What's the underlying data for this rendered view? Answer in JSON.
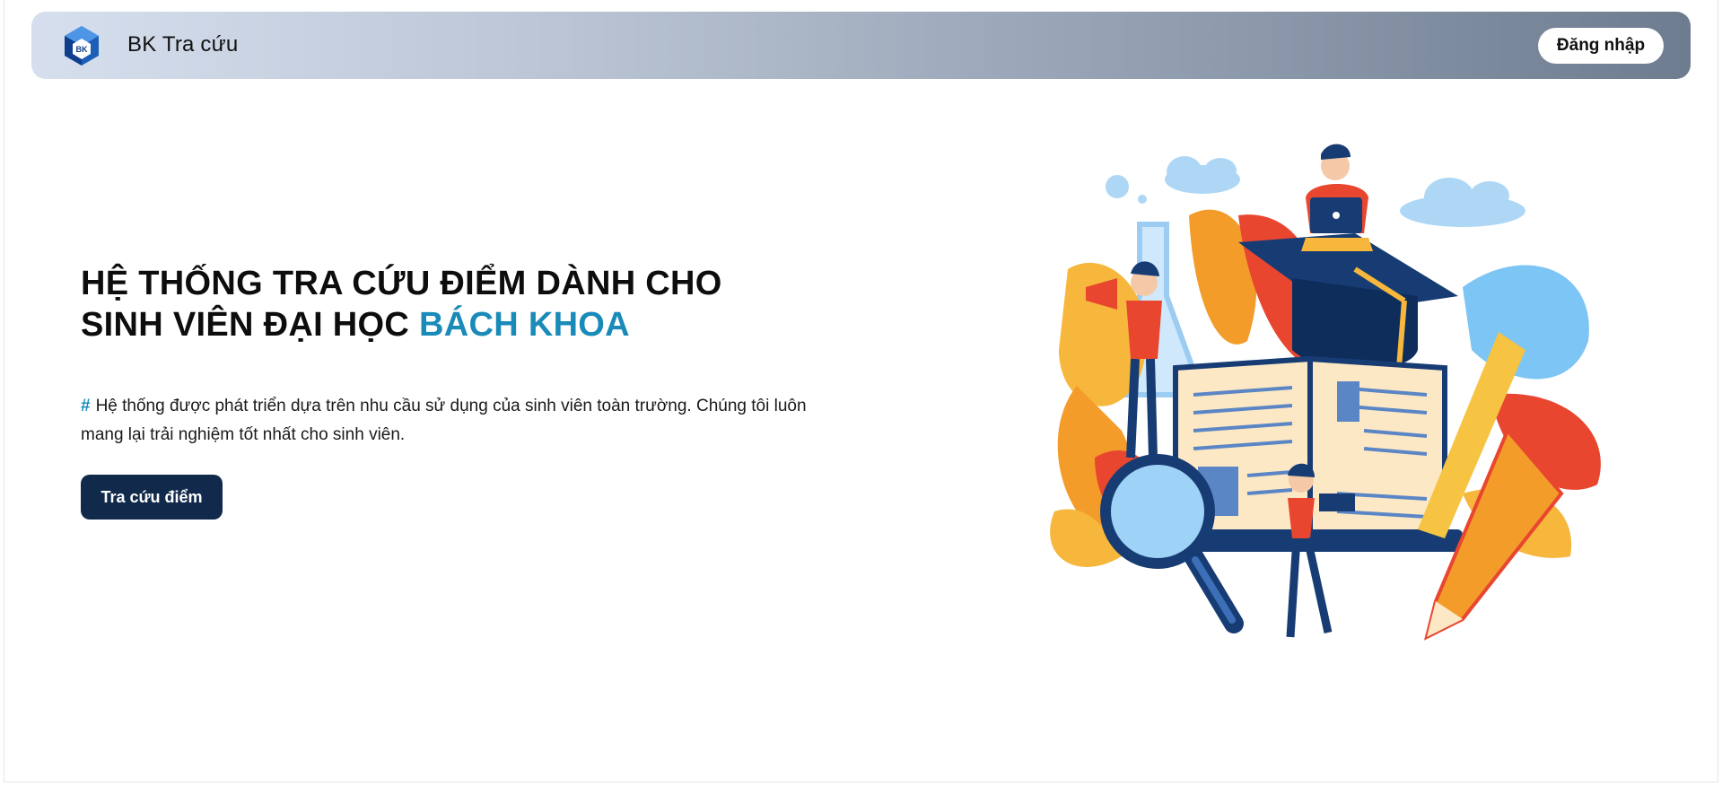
{
  "header": {
    "logo_text": "BK",
    "brand": "BK Tra cứu",
    "login_label": "Đăng nhập"
  },
  "hero": {
    "title_line1": "HỆ THỐNG TRA CỨU ĐIỂM DÀNH CHO",
    "title_line2_prefix": "SINH VIÊN ĐẠI HỌC ",
    "title_line2_accent": "BÁCH KHOA",
    "desc_hash": "#",
    "desc_text": "Hệ thống được phát triển dựa trên nhu cầu sử dụng của sinh viên toàn trường. Chúng tôi luôn mang lại trải nghiệm tốt nhất cho sinh viên.",
    "cta_label": "Tra cứu điểm"
  },
  "colors": {
    "accent": "#1a8bb8",
    "cta_bg": "#112a4b"
  },
  "icons": [
    "bk-logo-icon",
    "education-illustration"
  ]
}
